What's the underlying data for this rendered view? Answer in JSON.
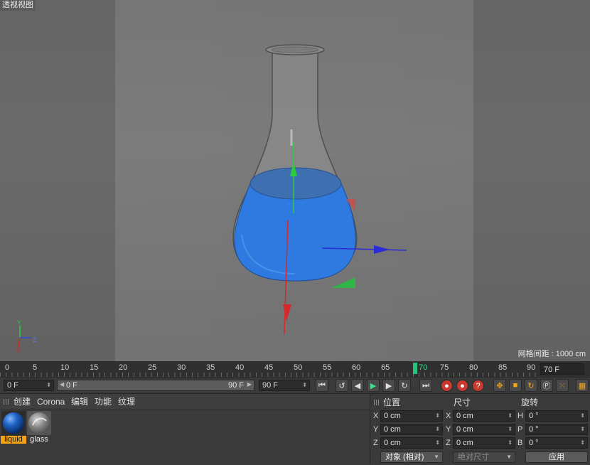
{
  "viewport": {
    "title": "透视视图",
    "grid_spacing": "网格间距 : 1000 cm",
    "axis_labels": {
      "x": "X",
      "y": "Y",
      "z": "Z"
    }
  },
  "timeline": {
    "ticks": [
      "0",
      "5",
      "10",
      "15",
      "20",
      "25",
      "30",
      "35",
      "40",
      "45",
      "50",
      "55",
      "60",
      "65",
      "70",
      "75",
      "80",
      "85",
      "90"
    ],
    "current_frame": "70",
    "current_frame_field": "70 F"
  },
  "transport": {
    "start_field": "0 F",
    "range_start": "0 F",
    "range_end": "90 F",
    "end_field": "90 F",
    "buttons": [
      "go-to-start",
      "prev-key",
      "prev-frame",
      "play",
      "next-frame",
      "next-key",
      "go-to-end"
    ]
  },
  "material_manager": {
    "menu": [
      "创建",
      "Corona",
      "编辑",
      "功能",
      "纹理"
    ],
    "materials": [
      {
        "name": "liquid",
        "selected": true,
        "color": "#1e63c4"
      },
      {
        "name": "glass",
        "selected": false,
        "color": "#9a9a9a"
      }
    ]
  },
  "coordinates": {
    "headers": {
      "position": "位置",
      "size": "尺寸",
      "rotation": "旋转"
    },
    "position": {
      "x_label": "X",
      "y_label": "Y",
      "z_label": "Z",
      "x": "0 cm",
      "y": "0 cm",
      "z": "0 cm"
    },
    "size": {
      "x_label": "X",
      "y_label": "Y",
      "z_label": "Z",
      "x": "0 cm",
      "y": "0 cm",
      "z": "0 cm"
    },
    "rotation": {
      "h_label": "H",
      "p_label": "P",
      "b_label": "B",
      "h": "0 °",
      "p": "0 °",
      "b": "0 °"
    },
    "mode": "对象 (相对)",
    "size_mode": "绝对尺寸",
    "apply": "应用"
  },
  "colors": {
    "liquid": "#2f7ae0",
    "accent": "#f3a413",
    "playhead": "#27c27a"
  }
}
